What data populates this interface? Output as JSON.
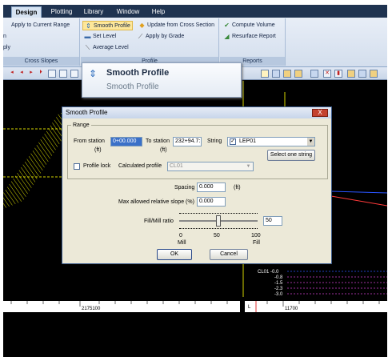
{
  "menu": {
    "tabs": [
      "Design",
      "Plotting",
      "Library",
      "Window",
      "Help"
    ],
    "active": "Design"
  },
  "ribbon": {
    "cross_slopes": {
      "items": [
        "Apply to Current Range",
        "n",
        "ply"
      ],
      "footer": "Cross Slopes"
    },
    "profile": {
      "items": [
        "Smooth Profile",
        "Update from Cross Section",
        "Set Level",
        "Apply by Grade",
        "Average Level"
      ],
      "footer": "Profile"
    },
    "reports": {
      "items": [
        "Compute Volume",
        "Resurface Report"
      ],
      "footer": "Reports"
    }
  },
  "tooltip": {
    "title": "Smooth Profile",
    "subtitle": "Smooth Profile"
  },
  "dialog": {
    "title": "Smooth Profile",
    "close_label": "X",
    "range_group": "Range",
    "from_station_label": "From station",
    "from_unit": "(ft)",
    "from_value": "0+00.000",
    "to_station_label": "To station",
    "to_unit": "(ft)",
    "to_value": "232+94.7:",
    "string_label": "String",
    "string_checked": true,
    "string_value": "LEP01",
    "select_one_label": "Select one string",
    "profile_lock_label": "Profile lock",
    "profile_lock_checked": false,
    "calc_profile_label": "Calculated profile",
    "calc_profile_value": "CL01",
    "spacing_label": "Spacing",
    "spacing_value": "0.000",
    "spacing_unit": "(ft)",
    "max_slope_label": "Max allowed relative slope (%)",
    "max_slope_value": "0.000",
    "fill_label": "Fill/Mill ratio",
    "fill_value": "50",
    "slider_fraction": 0.5,
    "scale_left_num": "0",
    "scale_mid_num": "50",
    "scale_right_num": "100",
    "scale_left_word": "Mill",
    "scale_right_word": "Fill",
    "ok_label": "OK",
    "cancel_label": "Cancel"
  },
  "drawing": {
    "ruler_left_label": "2175100",
    "ruler_right_label": "11700",
    "ruler_marker": "L",
    "layer_name": "CL01",
    "layer_values": [
      "-0.0",
      "-0.8",
      "-1.5",
      "-2.3",
      "-3.0"
    ]
  },
  "colors": {
    "accent_yellow": "#d4d400",
    "title_blue": "#1f3350",
    "highlight": "#fde79a"
  }
}
